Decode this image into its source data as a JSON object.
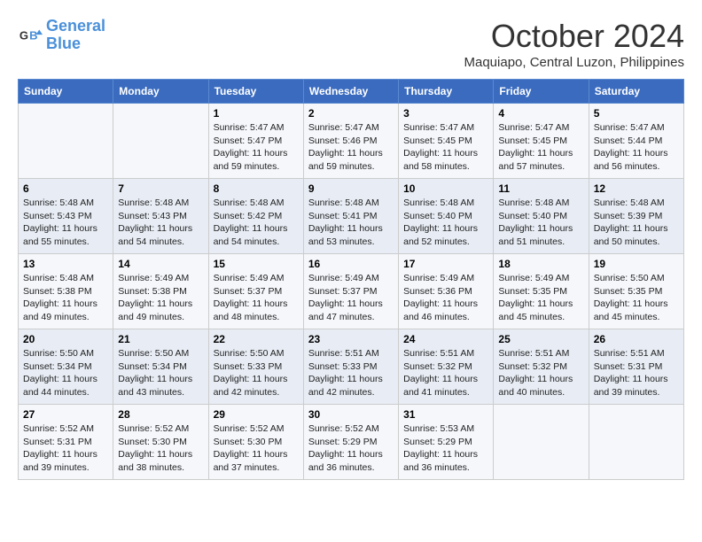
{
  "header": {
    "logo_line1": "General",
    "logo_line2": "Blue",
    "month": "October 2024",
    "location": "Maquiapo, Central Luzon, Philippines"
  },
  "days_of_week": [
    "Sunday",
    "Monday",
    "Tuesday",
    "Wednesday",
    "Thursday",
    "Friday",
    "Saturday"
  ],
  "weeks": [
    [
      {
        "num": "",
        "info": ""
      },
      {
        "num": "",
        "info": ""
      },
      {
        "num": "1",
        "info": "Sunrise: 5:47 AM\nSunset: 5:47 PM\nDaylight: 11 hours and 59 minutes."
      },
      {
        "num": "2",
        "info": "Sunrise: 5:47 AM\nSunset: 5:46 PM\nDaylight: 11 hours and 59 minutes."
      },
      {
        "num": "3",
        "info": "Sunrise: 5:47 AM\nSunset: 5:45 PM\nDaylight: 11 hours and 58 minutes."
      },
      {
        "num": "4",
        "info": "Sunrise: 5:47 AM\nSunset: 5:45 PM\nDaylight: 11 hours and 57 minutes."
      },
      {
        "num": "5",
        "info": "Sunrise: 5:47 AM\nSunset: 5:44 PM\nDaylight: 11 hours and 56 minutes."
      }
    ],
    [
      {
        "num": "6",
        "info": "Sunrise: 5:48 AM\nSunset: 5:43 PM\nDaylight: 11 hours and 55 minutes."
      },
      {
        "num": "7",
        "info": "Sunrise: 5:48 AM\nSunset: 5:43 PM\nDaylight: 11 hours and 54 minutes."
      },
      {
        "num": "8",
        "info": "Sunrise: 5:48 AM\nSunset: 5:42 PM\nDaylight: 11 hours and 54 minutes."
      },
      {
        "num": "9",
        "info": "Sunrise: 5:48 AM\nSunset: 5:41 PM\nDaylight: 11 hours and 53 minutes."
      },
      {
        "num": "10",
        "info": "Sunrise: 5:48 AM\nSunset: 5:40 PM\nDaylight: 11 hours and 52 minutes."
      },
      {
        "num": "11",
        "info": "Sunrise: 5:48 AM\nSunset: 5:40 PM\nDaylight: 11 hours and 51 minutes."
      },
      {
        "num": "12",
        "info": "Sunrise: 5:48 AM\nSunset: 5:39 PM\nDaylight: 11 hours and 50 minutes."
      }
    ],
    [
      {
        "num": "13",
        "info": "Sunrise: 5:48 AM\nSunset: 5:38 PM\nDaylight: 11 hours and 49 minutes."
      },
      {
        "num": "14",
        "info": "Sunrise: 5:49 AM\nSunset: 5:38 PM\nDaylight: 11 hours and 49 minutes."
      },
      {
        "num": "15",
        "info": "Sunrise: 5:49 AM\nSunset: 5:37 PM\nDaylight: 11 hours and 48 minutes."
      },
      {
        "num": "16",
        "info": "Sunrise: 5:49 AM\nSunset: 5:37 PM\nDaylight: 11 hours and 47 minutes."
      },
      {
        "num": "17",
        "info": "Sunrise: 5:49 AM\nSunset: 5:36 PM\nDaylight: 11 hours and 46 minutes."
      },
      {
        "num": "18",
        "info": "Sunrise: 5:49 AM\nSunset: 5:35 PM\nDaylight: 11 hours and 45 minutes."
      },
      {
        "num": "19",
        "info": "Sunrise: 5:50 AM\nSunset: 5:35 PM\nDaylight: 11 hours and 45 minutes."
      }
    ],
    [
      {
        "num": "20",
        "info": "Sunrise: 5:50 AM\nSunset: 5:34 PM\nDaylight: 11 hours and 44 minutes."
      },
      {
        "num": "21",
        "info": "Sunrise: 5:50 AM\nSunset: 5:34 PM\nDaylight: 11 hours and 43 minutes."
      },
      {
        "num": "22",
        "info": "Sunrise: 5:50 AM\nSunset: 5:33 PM\nDaylight: 11 hours and 42 minutes."
      },
      {
        "num": "23",
        "info": "Sunrise: 5:51 AM\nSunset: 5:33 PM\nDaylight: 11 hours and 42 minutes."
      },
      {
        "num": "24",
        "info": "Sunrise: 5:51 AM\nSunset: 5:32 PM\nDaylight: 11 hours and 41 minutes."
      },
      {
        "num": "25",
        "info": "Sunrise: 5:51 AM\nSunset: 5:32 PM\nDaylight: 11 hours and 40 minutes."
      },
      {
        "num": "26",
        "info": "Sunrise: 5:51 AM\nSunset: 5:31 PM\nDaylight: 11 hours and 39 minutes."
      }
    ],
    [
      {
        "num": "27",
        "info": "Sunrise: 5:52 AM\nSunset: 5:31 PM\nDaylight: 11 hours and 39 minutes."
      },
      {
        "num": "28",
        "info": "Sunrise: 5:52 AM\nSunset: 5:30 PM\nDaylight: 11 hours and 38 minutes."
      },
      {
        "num": "29",
        "info": "Sunrise: 5:52 AM\nSunset: 5:30 PM\nDaylight: 11 hours and 37 minutes."
      },
      {
        "num": "30",
        "info": "Sunrise: 5:52 AM\nSunset: 5:29 PM\nDaylight: 11 hours and 36 minutes."
      },
      {
        "num": "31",
        "info": "Sunrise: 5:53 AM\nSunset: 5:29 PM\nDaylight: 11 hours and 36 minutes."
      },
      {
        "num": "",
        "info": ""
      },
      {
        "num": "",
        "info": ""
      }
    ]
  ]
}
